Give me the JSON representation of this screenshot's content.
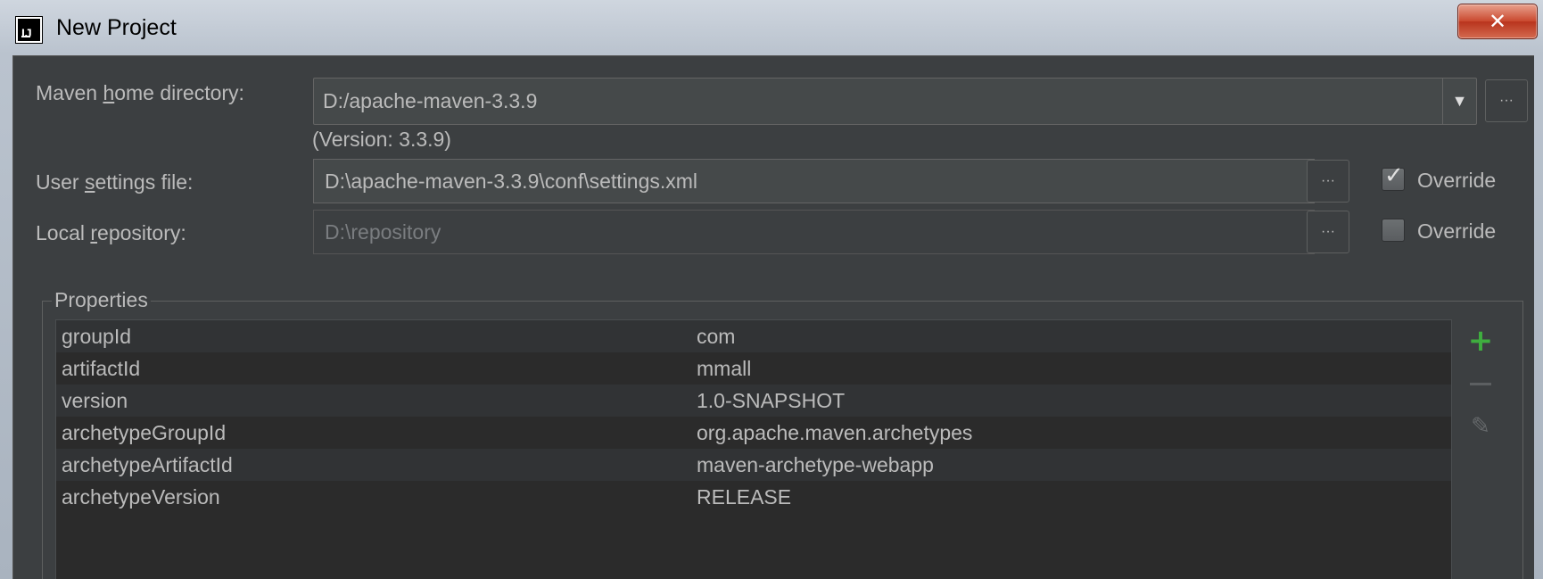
{
  "window": {
    "title": "New Project",
    "close_symbol": "✕",
    "app_icon": "IJ"
  },
  "maven": {
    "home_label_pre": "Maven ",
    "home_label_ul": "h",
    "home_label_post": "ome directory:",
    "home_value": "D:/apache-maven-3.3.9",
    "version_text": "(Version: 3.3.9)",
    "settings_label_pre": "User ",
    "settings_label_ul": "s",
    "settings_label_post": "ettings file:",
    "settings_value": "D:\\apache-maven-3.3.9\\conf\\settings.xml",
    "settings_override_label": "Override",
    "settings_override_checked": true,
    "repo_label_pre": "Local ",
    "repo_label_ul": "r",
    "repo_label_post": "epository:",
    "repo_value": "D:\\repository",
    "repo_override_label": "Override",
    "repo_override_checked": false,
    "browse_label": "···",
    "dropdown_icon": "triangle-down-icon"
  },
  "properties": {
    "title": "Properties",
    "rows": [
      {
        "key": "groupId",
        "value": "com"
      },
      {
        "key": "artifactId",
        "value": "mmall"
      },
      {
        "key": "version",
        "value": "1.0-SNAPSHOT"
      },
      {
        "key": "archetypeGroupId",
        "value": "org.apache.maven.archetypes"
      },
      {
        "key": "archetypeArtifactId",
        "value": "maven-archetype-webapp"
      },
      {
        "key": "archetypeVersion",
        "value": "RELEASE"
      }
    ]
  },
  "colors": {
    "panel_bg": "#3c3f41",
    "field_bg": "#45494a",
    "text": "#bbbbbb",
    "add_green": "#3fae3f",
    "close_red": "#c9482e"
  }
}
